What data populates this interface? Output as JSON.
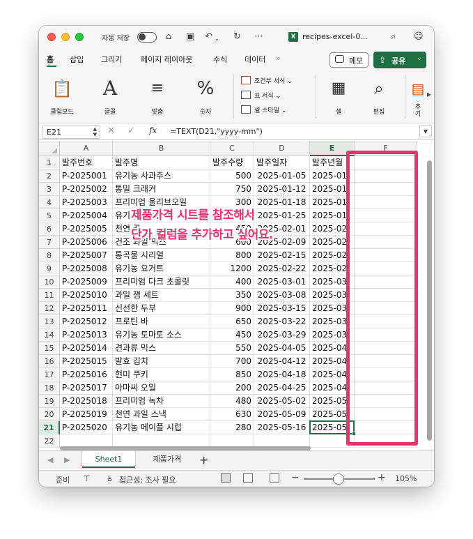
{
  "titlebar": {
    "autosave_label": "자동 저장",
    "file_name": "recipes-excel-0..."
  },
  "ribbon_tabs": [
    "홈",
    "삽입",
    "그리기",
    "페이지 레이아웃",
    "수식",
    "데이터"
  ],
  "ribbon_more": "»",
  "memo_label": "메모",
  "share_label": "공유",
  "ribbon": {
    "clipboard": "클립보드",
    "font": "글꼴",
    "align": "맞춤",
    "number": "숫자",
    "cond_format": "조건부 서식",
    "table_format": "표 서식",
    "cell_style": "셀 스타일",
    "cells": "셀",
    "editing": "편집",
    "addin_1": "추",
    "addin_2": "기"
  },
  "formula_bar": {
    "name_box": "E21",
    "formula": "=TEXT(D21,\"yyyy-mm\")"
  },
  "columns": [
    "A",
    "B",
    "C",
    "D",
    "E",
    "F"
  ],
  "rows": [
    [
      "발주번호",
      "발주명",
      "발주수량",
      "발주일자",
      "발주년월"
    ],
    [
      "P-2025001",
      "유기농 사과주스",
      "500",
      "2025-01-05",
      "2025-01"
    ],
    [
      "P-2025002",
      "통밀 크래커",
      "750",
      "2025-01-12",
      "2025-01"
    ],
    [
      "P-2025003",
      "프리미엄 올리브오일",
      "300",
      "2025-01-18",
      "2025-01"
    ],
    [
      "P-2025004",
      "유기농 그래놀라",
      "1000",
      "2025-01-25",
      "2025-01"
    ],
    [
      "P-2025005",
      "천연 꿀",
      "450",
      "2025-02-01",
      "2025-02"
    ],
    [
      "P-2025006",
      "건조 과일 믹스",
      "600",
      "2025-02-09",
      "2025-02"
    ],
    [
      "P-2025007",
      "통곡물 시리얼",
      "800",
      "2025-02-15",
      "2025-02"
    ],
    [
      "P-2025008",
      "유기농 요거트",
      "1200",
      "2025-02-22",
      "2025-02"
    ],
    [
      "P-2025009",
      "프리미엄 다크 초콜릿",
      "400",
      "2025-03-01",
      "2025-03"
    ],
    [
      "P-2025010",
      "과일 잼 세트",
      "350",
      "2025-03-08",
      "2025-03"
    ],
    [
      "P-2025011",
      "신선한 두부",
      "900",
      "2025-03-15",
      "2025-03"
    ],
    [
      "P-2025012",
      "프로틴 바",
      "650",
      "2025-03-22",
      "2025-03"
    ],
    [
      "P-2025013",
      "유기농 토마토 소스",
      "450",
      "2025-03-29",
      "2025-03"
    ],
    [
      "P-2025014",
      "견과류 믹스",
      "550",
      "2025-04-05",
      "2025-04"
    ],
    [
      "P-2025015",
      "발효 김치",
      "700",
      "2025-04-12",
      "2025-04"
    ],
    [
      "P-2025016",
      "현미 쿠키",
      "850",
      "2025-04-18",
      "2025-04"
    ],
    [
      "P-2025017",
      "아마씨 오일",
      "200",
      "2025-04-25",
      "2025-04"
    ],
    [
      "P-2025018",
      "프리미엄 녹차",
      "480",
      "2025-05-02",
      "2025-05"
    ],
    [
      "P-2025019",
      "천연 과일 스낵",
      "630",
      "2025-05-09",
      "2025-05"
    ],
    [
      "P-2025020",
      "유기농 메이플 시럽",
      "280",
      "2025-05-16",
      "2025-05"
    ],
    [
      "",
      "",
      "",
      "",
      ""
    ]
  ],
  "sheet_tabs": [
    "Sheet1",
    "제품가격"
  ],
  "statusbar": {
    "ready": "준비",
    "accessibility": "접근성: 조사 필요",
    "zoom": "105%"
  },
  "annotation": {
    "line1": "제품가격 시트를 참조해서",
    "line2": "단가 컬럼을 추가하고 싶어요."
  },
  "colors": {
    "excel_green": "#1d7044",
    "annotation_pink": "#f0306e"
  }
}
